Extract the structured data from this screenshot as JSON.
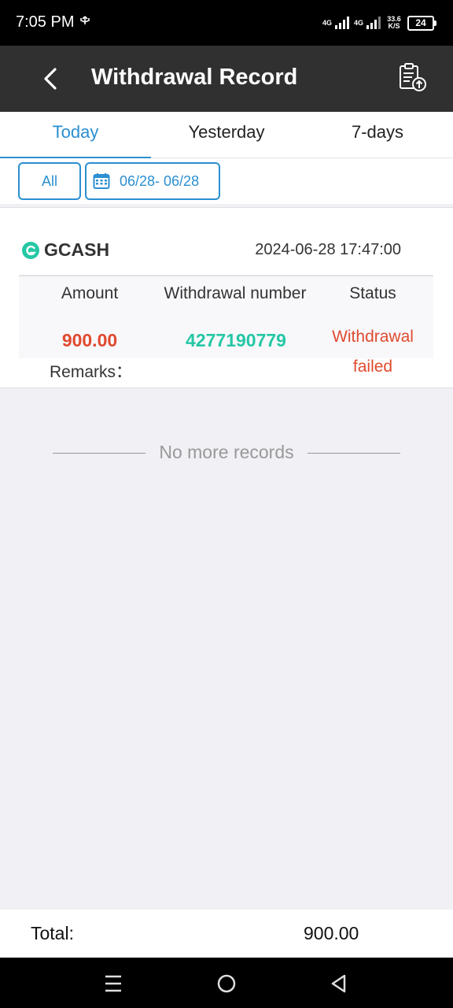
{
  "status_bar": {
    "time": "7:05 PM",
    "notification_icon": "usb-icon",
    "network1": "4G",
    "network2": "4G",
    "speed_value": "33.6",
    "speed_unit": "K/S",
    "battery": "24"
  },
  "header": {
    "title": "Withdrawal Record",
    "back_icon": "chevron-left-icon",
    "action_icon": "clipboard-upload-icon"
  },
  "tabs": [
    {
      "label": "Today",
      "active": true
    },
    {
      "label": "Yesterday",
      "active": false
    },
    {
      "label": "7-days",
      "active": false
    }
  ],
  "filters": {
    "all_label": "All",
    "date_range": "06/28- 06/28"
  },
  "record": {
    "method": "GCASH",
    "datetime": "2024-06-28 17:47:00",
    "headers": {
      "amount": "Amount",
      "number": "Withdrawal number",
      "status": "Status"
    },
    "amount": "900.00",
    "withdrawal_number": "4277190779",
    "status": "Withdrawal failed",
    "remarks_label": "Remarks："
  },
  "no_more_text": "No more records",
  "total": {
    "label": "Total:",
    "value": "900.00"
  },
  "colors": {
    "accent": "#2b8fd1",
    "header_bg": "#303030",
    "amount_red": "#e04a2f",
    "number_green": "#25c7a4",
    "page_bg": "#f0f0f5"
  }
}
